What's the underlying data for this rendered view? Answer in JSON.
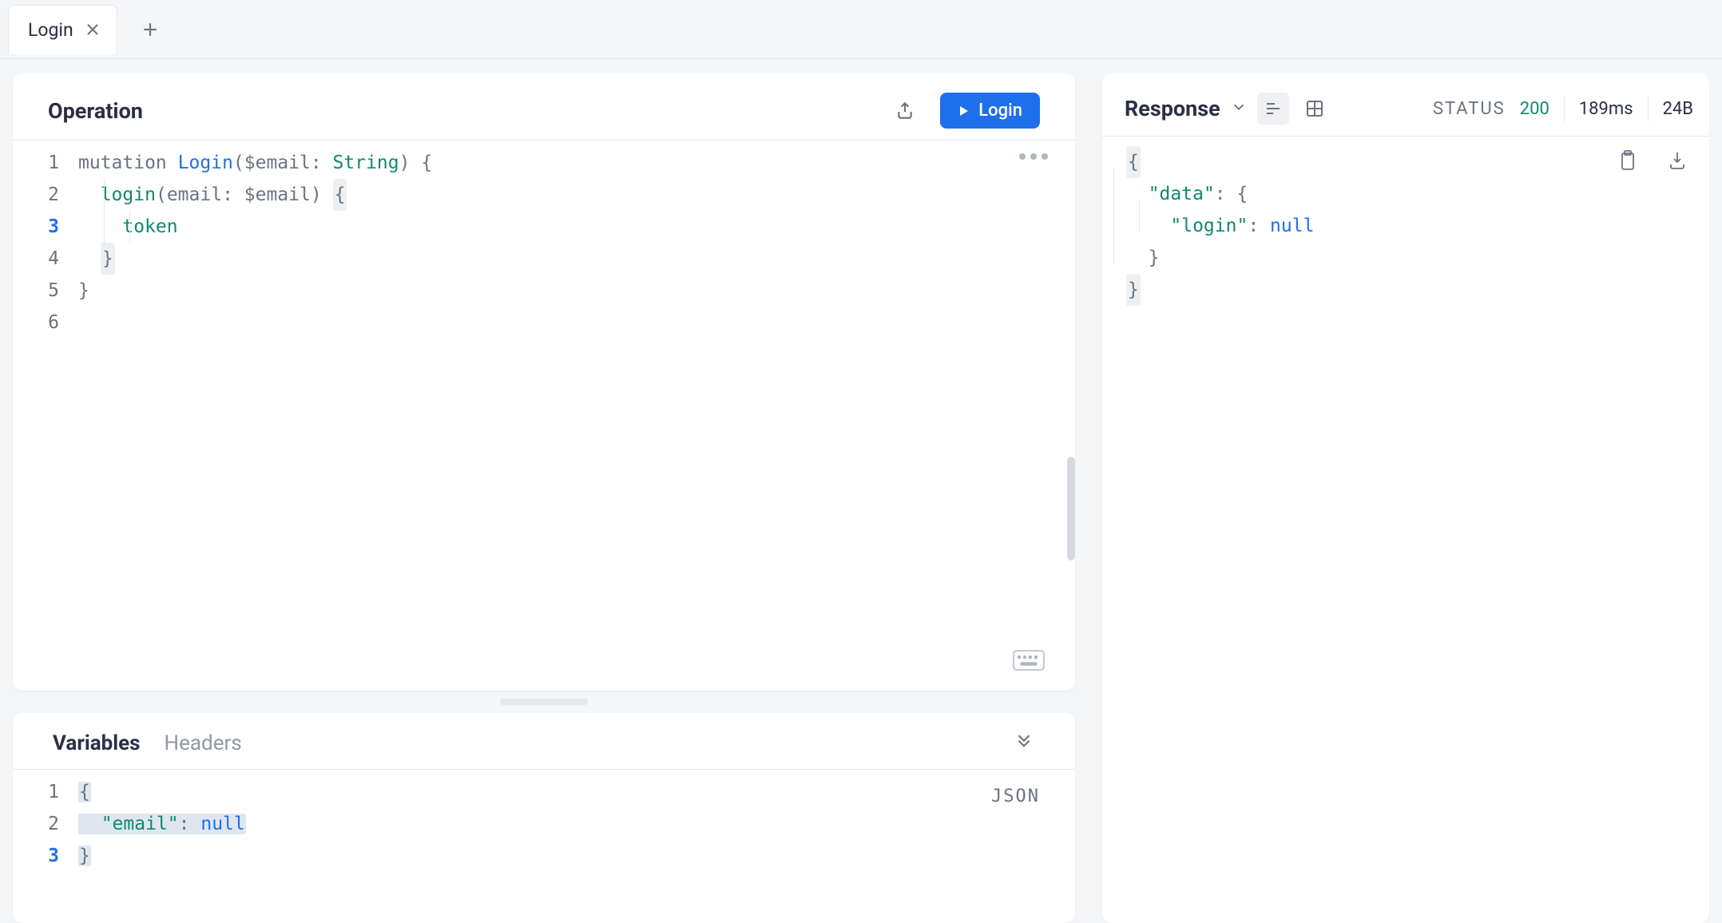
{
  "tabs": {
    "active": "Login"
  },
  "operation": {
    "title": "Operation",
    "run_label": "Login",
    "gutter": [
      "1",
      "2",
      "3",
      "4",
      "5",
      "6"
    ],
    "current_line_index": 2,
    "code": {
      "l1_kw": "mutation",
      "l1_name": "Login",
      "l1_var": "$email",
      "l1_type": "String",
      "l2_field": "login",
      "l2_arg": "email",
      "l2_var": "$email",
      "l3_field": "token"
    }
  },
  "variables": {
    "tab_vars": "Variables",
    "tab_headers": "Headers",
    "badge": "JSON",
    "gutter": [
      "1",
      "2",
      "3"
    ],
    "current_line_index": 2,
    "code": {
      "key": "\"email\"",
      "val": "null"
    }
  },
  "response": {
    "title": "Response",
    "status_label": "STATUS",
    "status_code": "200",
    "time": "189ms",
    "size": "24B",
    "json": {
      "data_key": "\"data\"",
      "login_key": "\"login\"",
      "login_val": "null"
    }
  }
}
